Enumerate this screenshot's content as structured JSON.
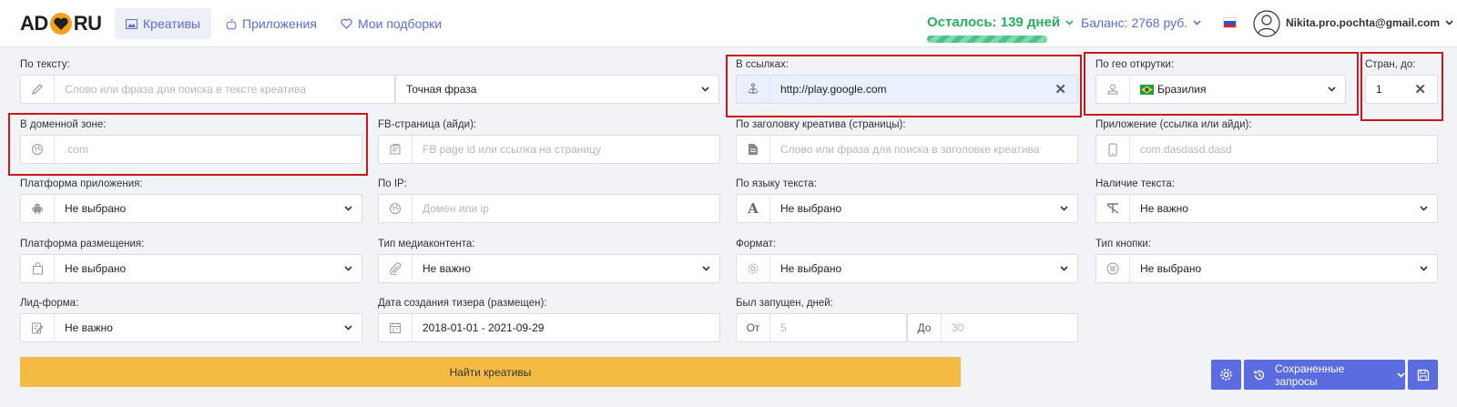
{
  "header": {
    "logo_left": "AD",
    "logo_right": "RU",
    "nav": [
      {
        "label": "Креативы",
        "icon": "image-icon"
      },
      {
        "label": "Приложения",
        "icon": "apps-icon"
      },
      {
        "label": "Мои подборки",
        "icon": "heart-icon"
      }
    ],
    "days_left": "Осталось: 139 дней",
    "days_progress": 0.9,
    "balance": "Баланс: 2768 руб.",
    "user_email": "Nikita.pro.pochta@gmail.com"
  },
  "filters": {
    "text": {
      "label": "По тексту:",
      "placeholder": "Слово или фраза для поиска в тексте креатива",
      "mode": "Точная фраза"
    },
    "links": {
      "label": "В ссылках:",
      "value": "http://play.google.com"
    },
    "geo": {
      "label": "По гео открутки:",
      "value": "Бразилия"
    },
    "countries": {
      "label": "Стран, до:",
      "value": "1"
    },
    "domain": {
      "label": "В доменной зоне:",
      "placeholder": ".com"
    },
    "fb_page": {
      "label": "FB-страница (айди):",
      "placeholder": "FB page id или ссылка на страницу"
    },
    "headline": {
      "label": "По заголовку креатива (страницы):",
      "placeholder": "Слово или фраза для поиска в заголовке креатива"
    },
    "app": {
      "label": "Приложение (ссылка или айди):",
      "placeholder": "com.dasdasd.dasd"
    },
    "app_platform": {
      "label": "Платформа приложения:",
      "value": "Не выбрано"
    },
    "ip": {
      "label": "По IP:",
      "placeholder": "Домен или  ip"
    },
    "language": {
      "label": "По языку текста:",
      "value": "Не выбрано"
    },
    "has_text": {
      "label": "Наличие текста:",
      "value": "Не важно"
    },
    "placement": {
      "label": "Платформа размещения:",
      "value": "Не выбрано"
    },
    "media_type": {
      "label": "Тип медиаконтента:",
      "value": "Не важно"
    },
    "format": {
      "label": "Формат:",
      "value": "Не выбрано"
    },
    "button_type": {
      "label": "Тип кнопки:",
      "value": "Не выбрано"
    },
    "lead_form": {
      "label": "Лид-форма:",
      "value": "Не важно"
    },
    "created": {
      "label": "Дата создания тизера (размещен):",
      "value": "2018-01-01 - 2021-09-29"
    },
    "running": {
      "label": "Был запущен, дней:",
      "from_label": "От",
      "from_placeholder": "5",
      "to_label": "До",
      "to_placeholder": "30"
    }
  },
  "actions": {
    "find": "Найти креативы",
    "saved": "Сохраненные запросы"
  },
  "colors": {
    "accent": "#5b6be0",
    "find": "#f4bb44",
    "highlight": "#c9181e",
    "days": "#27ae60"
  }
}
